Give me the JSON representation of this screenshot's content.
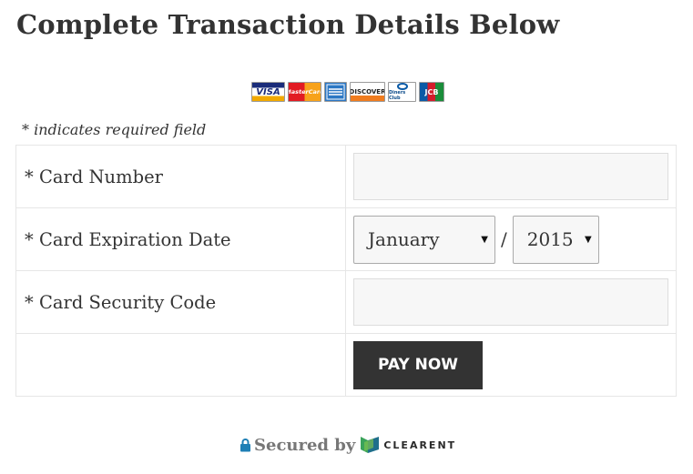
{
  "page": {
    "title": "Complete Transaction Details Below"
  },
  "card_logos": [
    {
      "icon": "visa-card-icon",
      "text": "VISA"
    },
    {
      "icon": "mastercard-icon",
      "text": "MasterCard"
    },
    {
      "icon": "amex-card-icon",
      "text": ""
    },
    {
      "icon": "discover-card-icon",
      "text": "DISCOVER"
    },
    {
      "icon": "diners-club-card-icon",
      "text": "Diners Club"
    },
    {
      "icon": "jcb-card-icon",
      "text": "JCB"
    }
  ],
  "form": {
    "required_note": "* indicates required field",
    "card_number_label": "* Card Number",
    "card_number_value": "",
    "expiration_label": "* Card Expiration Date",
    "expiration_month": "January",
    "expiration_separator": "/",
    "expiration_year": "2015",
    "security_code_label": "* Card Security Code",
    "security_code_value": "",
    "pay_button": "PAY NOW"
  },
  "footer": {
    "secured_by": "Secured by",
    "brand": "CLEARENT",
    "lock_icon": "lock-icon",
    "brand_icon": "clearent-logo-icon",
    "colors": {
      "lock": "#1e7fb5",
      "brand_mark_green": "#3aa35a",
      "brand_mark_teal": "#1f6f8b"
    }
  },
  "colors": {
    "text": "#333333",
    "button_bg": "#333333",
    "button_text": "#ffffff",
    "input_bg": "#f7f7f7",
    "table_border": "#e6e6e6"
  }
}
